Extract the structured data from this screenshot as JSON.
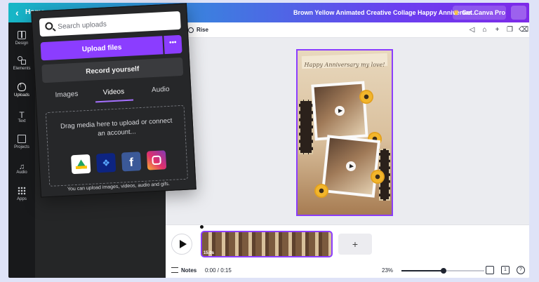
{
  "topbar": {
    "back_glyph": "‹",
    "home_label": "Home",
    "design_title": "Brown Yellow Animated Creative Collage Happy Anniversar...",
    "pro_label": "Get Canva Pro",
    "crown_icon": "crown-icon"
  },
  "rail": {
    "items": [
      {
        "label": "Design",
        "icon": "design-icon"
      },
      {
        "label": "Elements",
        "icon": "elements-icon"
      },
      {
        "label": "Uploads",
        "icon": "upload-cloud-icon",
        "active": true
      },
      {
        "label": "Text",
        "icon": "text-icon"
      },
      {
        "label": "Projects",
        "icon": "folder-icon"
      },
      {
        "label": "Audio",
        "icon": "music-note-icon"
      },
      {
        "label": "Apps",
        "icon": "apps-grid-icon"
      }
    ]
  },
  "uploads_panel": {
    "search_placeholder": "Search uploads",
    "upload_label": "Upload files",
    "more_glyph": "•••",
    "record_label": "Record yourself",
    "tabs": [
      "Images",
      "Videos",
      "Audio"
    ],
    "active_tab": "Videos",
    "drop_message": "Drag media here to upload or connect an account...",
    "sources": [
      "Google Drive",
      "Dropbox",
      "Facebook",
      "Instagram"
    ],
    "facebook_glyph": "f",
    "dropbox_glyph": "❖",
    "note": "You can upload images, videos, audio and gifs."
  },
  "context_bar": {
    "animation_label": "Rise"
  },
  "canvas": {
    "headline": "Happy Anniversary my love!"
  },
  "timeline": {
    "clip_duration": "15.0s",
    "add_glyph": "+"
  },
  "bottom_bar": {
    "notes_label": "Notes",
    "time": "0:00 / 0:15",
    "zoom": "23%",
    "zoom_fraction": 0.23,
    "page_count": "1",
    "help_glyph": "?"
  },
  "colors": {
    "accent": "#8b3dff",
    "panel_bg": "#252627",
    "rail_bg": "#18191b"
  }
}
